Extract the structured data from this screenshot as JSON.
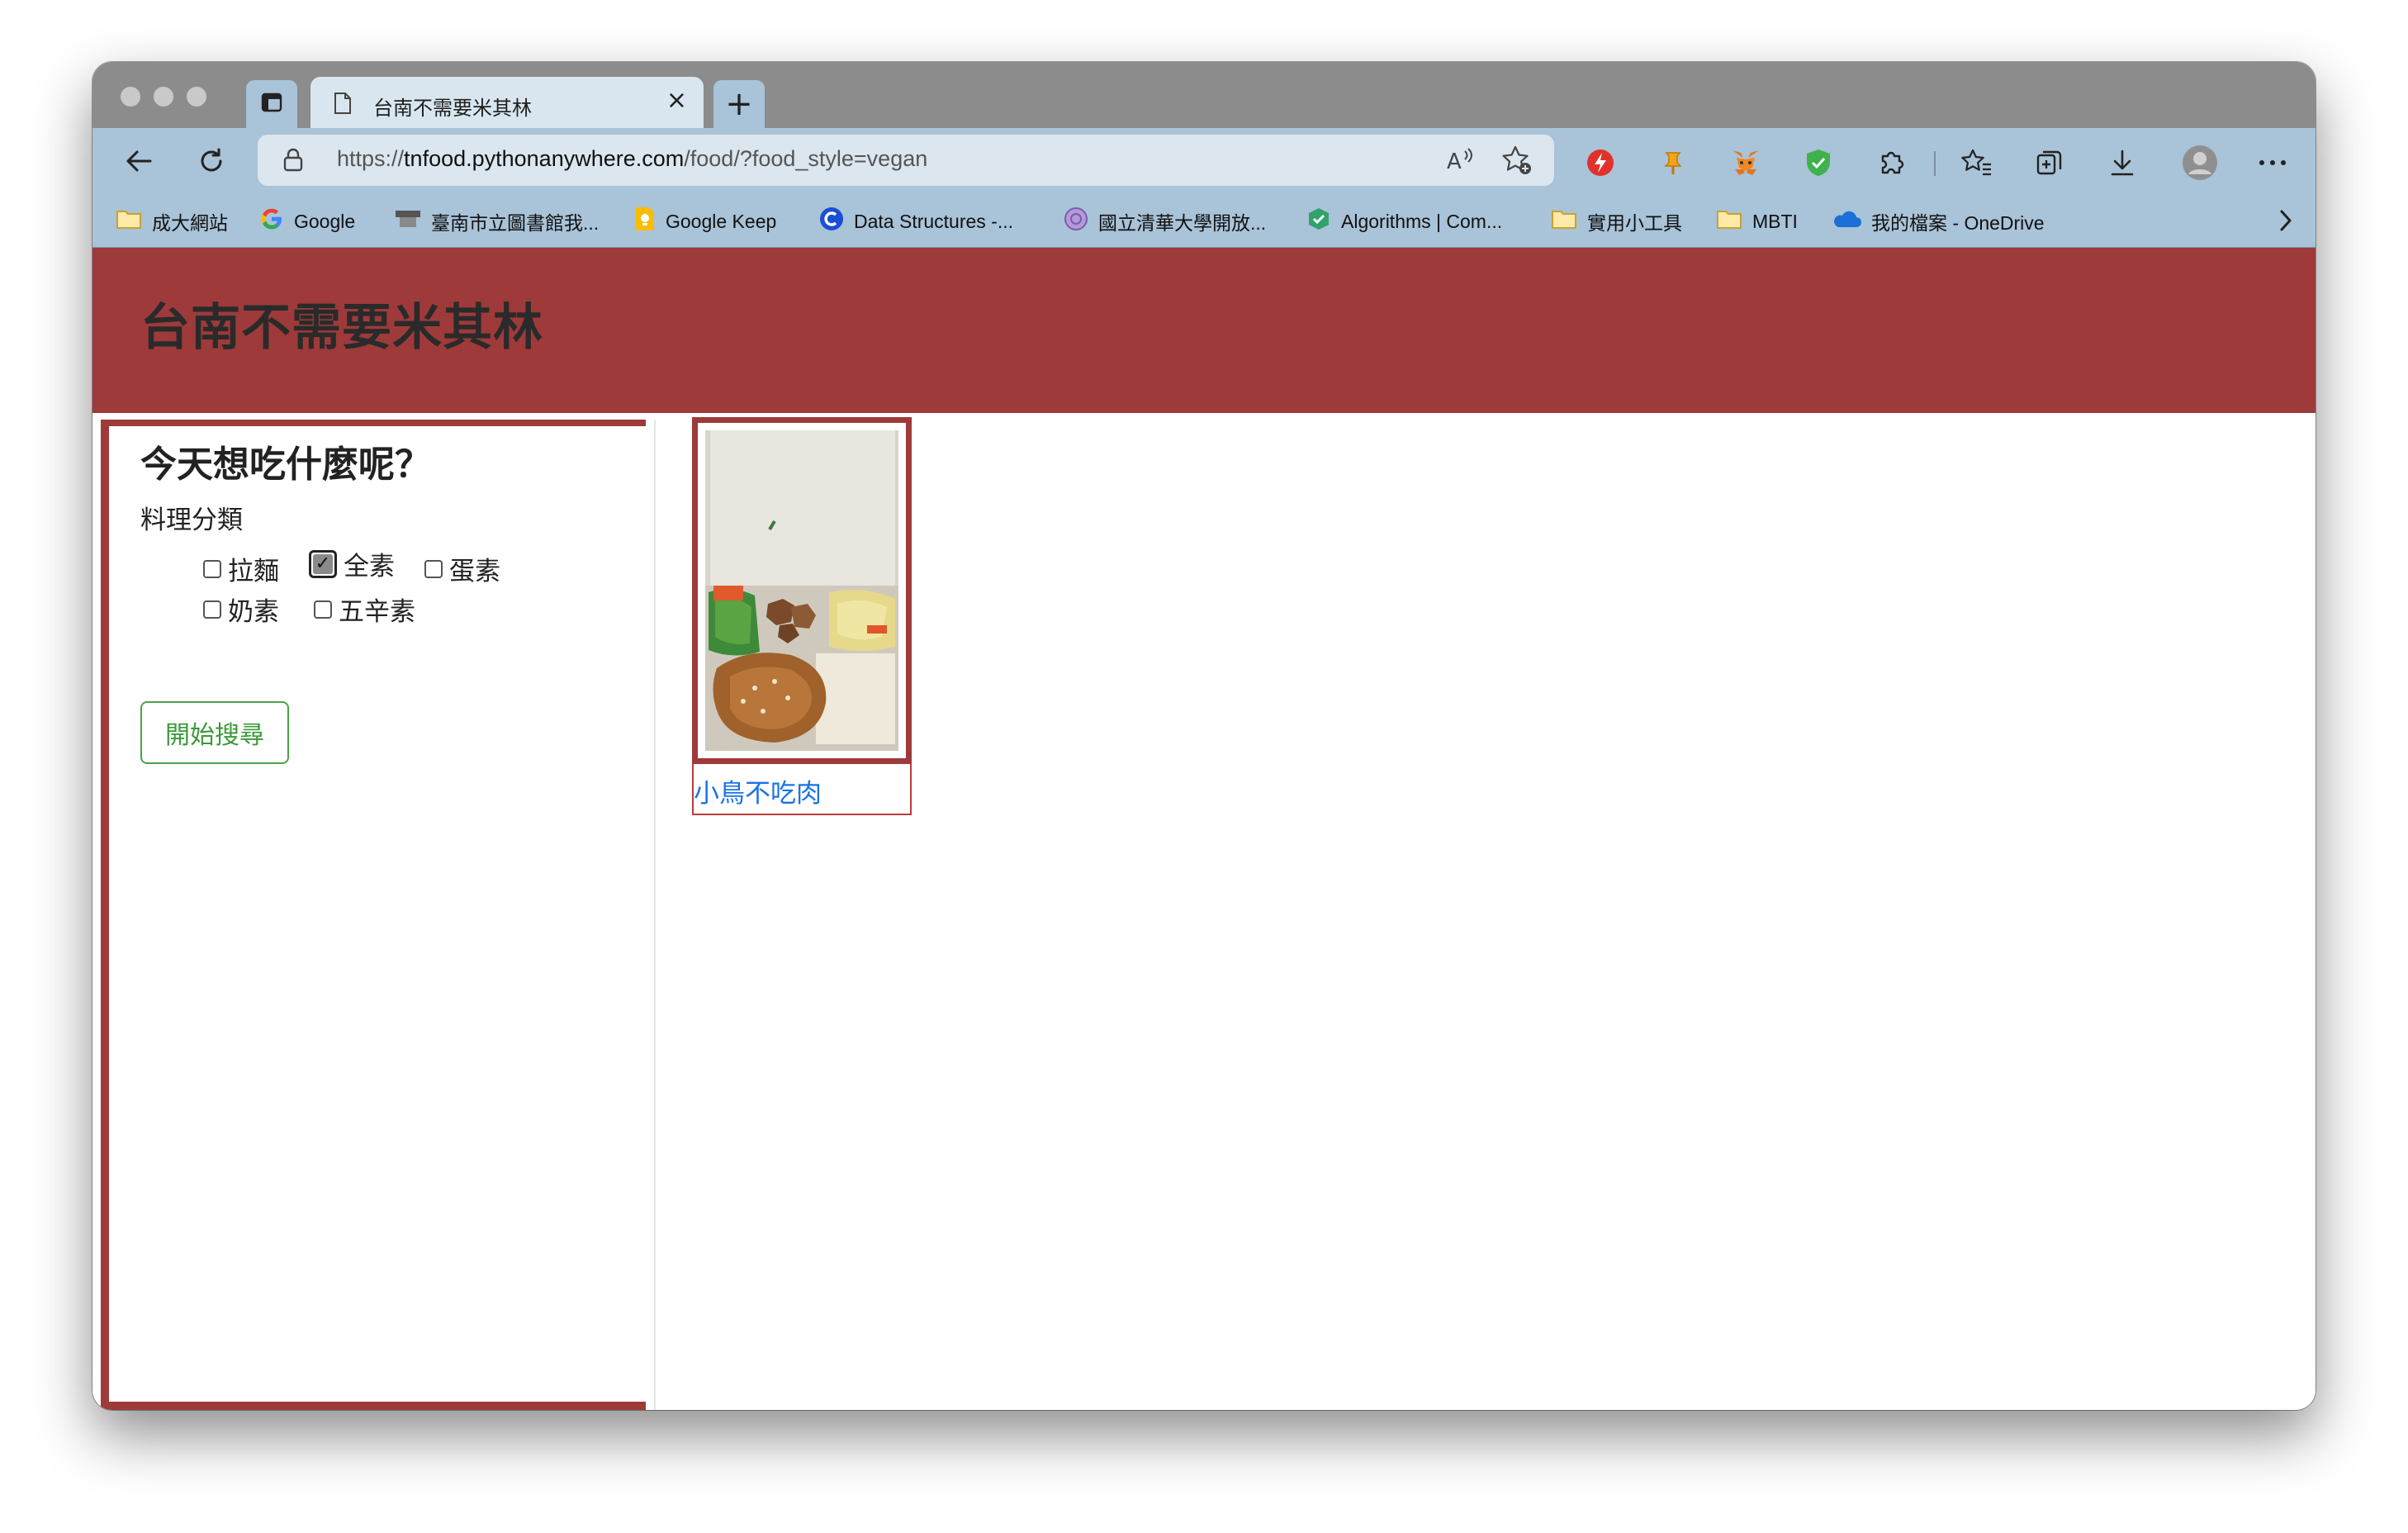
{
  "browser": {
    "tab": {
      "title": "台南不需要米其林",
      "close_symbol": "×"
    },
    "new_tab_symbol": "+",
    "address": {
      "scheme": "https://",
      "domain": "tnfood.pythonanywhere.com",
      "path": "/food/?food_style=vegan"
    },
    "bookmarks": [
      {
        "label": "成大網站",
        "icon": "folder-icon"
      },
      {
        "label": "Google",
        "icon": "google-icon"
      },
      {
        "label": "臺南市立圖書館我...",
        "icon": "library-icon"
      },
      {
        "label": "Google Keep",
        "icon": "keep-icon"
      },
      {
        "label": "Data Structures -...",
        "icon": "c-logo-icon"
      },
      {
        "label": "國立清華大學開放...",
        "icon": "purple-seal-icon"
      },
      {
        "label": "Algorithms | Com...",
        "icon": "green-check-icon"
      },
      {
        "label": "實用小工具",
        "icon": "folder-icon"
      },
      {
        "label": "MBTI",
        "icon": "folder-icon"
      },
      {
        "label": "我的檔案 - OneDrive",
        "icon": "onedrive-icon"
      }
    ]
  },
  "page": {
    "site_title": "台南不需要米其林",
    "sidebar": {
      "heading": "今天想吃什麼呢？",
      "category_label": "料理分類",
      "options": [
        {
          "label": "拉麵",
          "checked": false
        },
        {
          "label": "全素",
          "checked": true
        },
        {
          "label": "蛋素",
          "checked": false
        },
        {
          "label": "奶素",
          "checked": false
        },
        {
          "label": "五辛素",
          "checked": false
        }
      ],
      "search_button": "開始搜尋"
    },
    "results": [
      {
        "name": "小鳥不吃肉"
      }
    ]
  },
  "colors": {
    "header_bg": "#9e3a3a",
    "chrome_bg": "#a9c3d8",
    "link": "#1a73e8",
    "search_button": "#3a9a3a"
  }
}
